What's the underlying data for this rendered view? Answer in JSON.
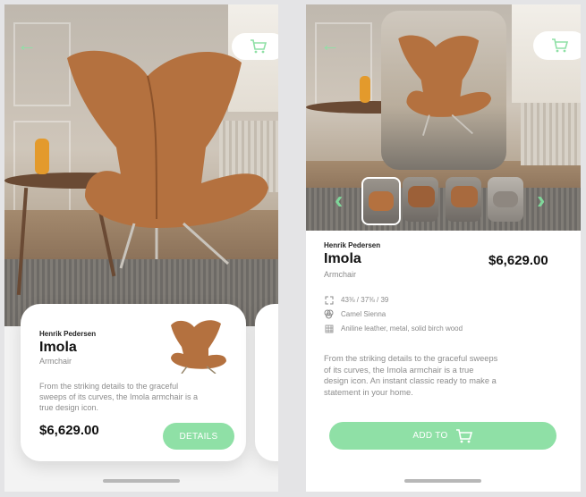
{
  "product": {
    "designer": "Henrik Pedersen",
    "name": "Imola",
    "type": "Armchair",
    "description_short": "From the striking details to the graceful sweeps of its curves, the Imola armchair is a true design icon.",
    "description_long": "From the striking details to the graceful sweeps of its curves, the Imola armchair is a true design icon. An instant classic ready to make a statement in your home.",
    "price": "$6,629.00"
  },
  "specs": [
    {
      "icon": "dimensions-icon",
      "text": "43⅜ / 37⅜ / 39"
    },
    {
      "icon": "color-swatch-icon",
      "text": "Camel Sienna"
    },
    {
      "icon": "material-icon",
      "text": "Aniline leather, metal, solid birch wood"
    }
  ],
  "buttons": {
    "details": "DETAILS",
    "add_to": "ADD TO"
  },
  "icons": {
    "back": "back-arrow-icon",
    "cart": "cart-icon"
  },
  "colors": {
    "accent": "#8fe0a6"
  }
}
